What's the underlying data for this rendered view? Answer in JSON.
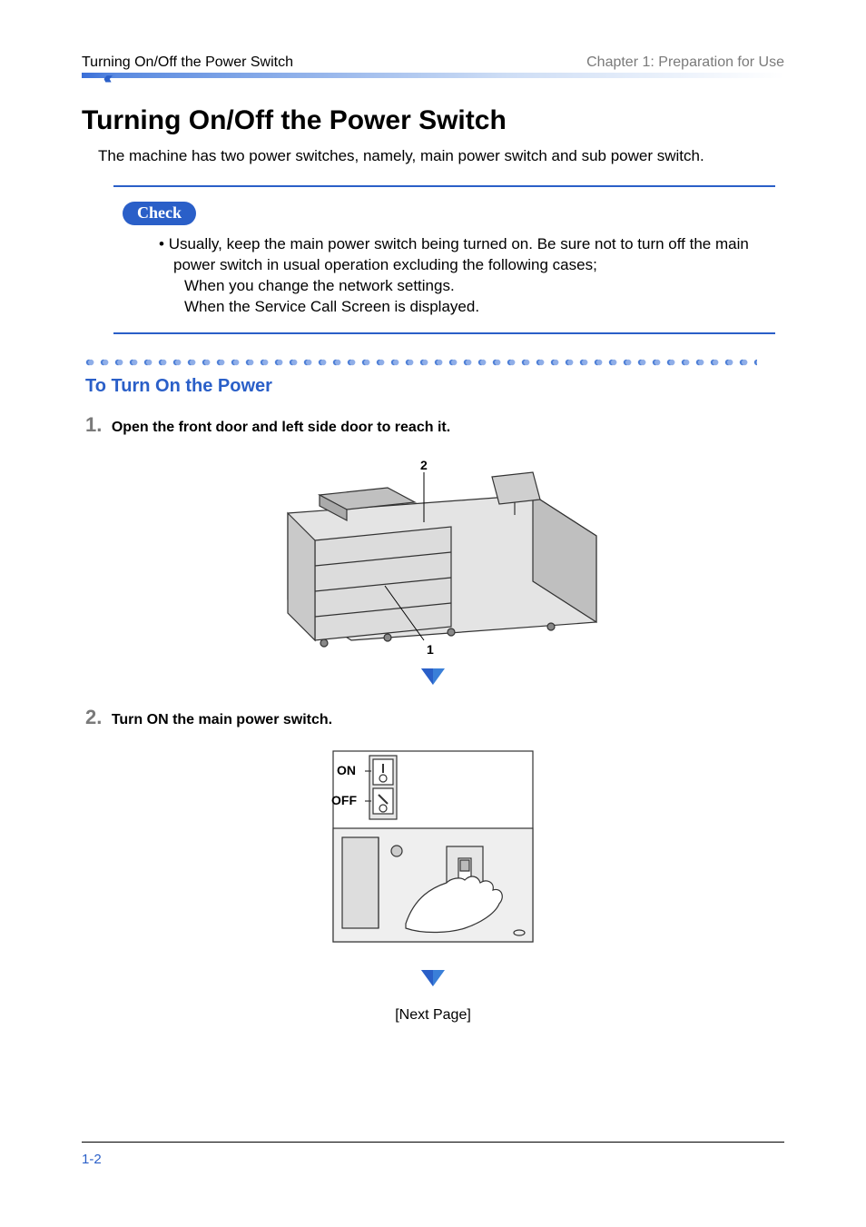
{
  "header": {
    "section": "Turning On/Off the Power Switch",
    "chapter": "Chapter 1: Preparation for Use"
  },
  "title": "Turning On/Off the Power Switch",
  "intro": "The machine has two power switches, namely, main power switch and sub power switch.",
  "check": {
    "badge": "Check",
    "bullet": "Usually, keep the main power switch being turned on. Be sure not to turn off the main power switch in usual operation excluding the following cases;",
    "sub1": "When you change the network settings.",
    "sub2": "When the Service Call Screen is displayed."
  },
  "subheading": "To Turn On the Power",
  "steps": [
    {
      "num": "1.",
      "text": "Open the front door and left side door to reach it."
    },
    {
      "num": "2.",
      "text": "Turn ON the main power switch."
    }
  ],
  "fig1": {
    "label_top": "2",
    "label_bottom": "1"
  },
  "fig2": {
    "on": "ON",
    "off": "OFF"
  },
  "next_page": "[Next Page]",
  "page_number": "1-2"
}
